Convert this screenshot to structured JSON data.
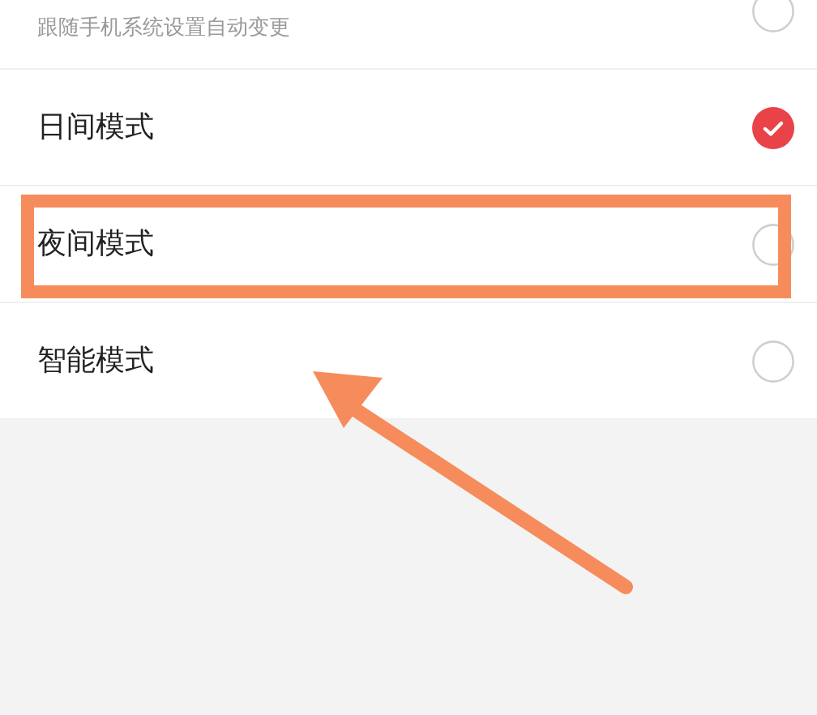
{
  "follow_system": {
    "subtitle": "跟随手机系统设置自动变更",
    "selected": false
  },
  "modes": [
    {
      "label": "日间模式",
      "selected": true
    },
    {
      "label": "夜间模式",
      "selected": false
    },
    {
      "label": "智能模式",
      "selected": false
    }
  ]
}
